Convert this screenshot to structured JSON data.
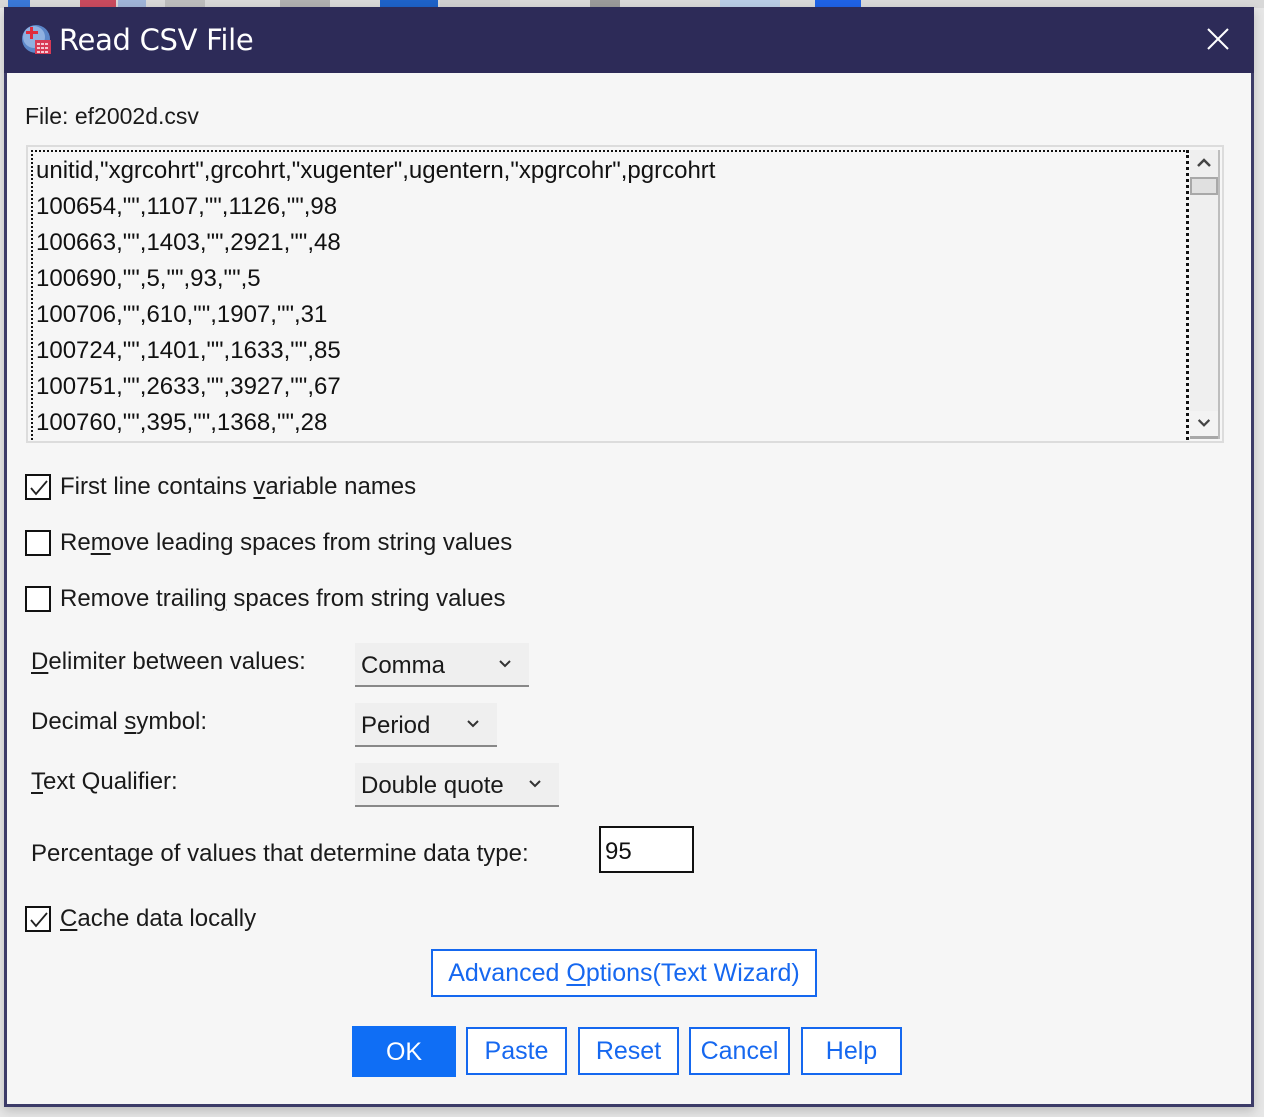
{
  "window": {
    "title": "Read CSV File",
    "close_icon": "close-icon",
    "app_icon": "spss-data-icon"
  },
  "file": {
    "label": "File: ef2002d.csv"
  },
  "preview": {
    "lines": [
      "unitid,\"xgrcohrt\",grcohrt,\"xugenter\",ugentern,\"xpgrcohr\",pgrcohrt",
      "100654,\"\",1107,\"\",1126,\"\",98",
      "100663,\"\",1403,\"\",2921,\"\",48",
      "100690,\"\",5,\"\",93,\"\",5",
      "100706,\"\",610,\"\",1907,\"\",31",
      "100724,\"\",1401,\"\",1633,\"\",85",
      "100751,\"\",2633,\"\",3927,\"\",67",
      "100760,\"\",395,\"\",1368,\"\",28"
    ],
    "scroll_up_icon": "chevron-up-icon",
    "scroll_down_icon": "chevron-down-icon"
  },
  "options": {
    "first_line": {
      "pre": "First line contains ",
      "u": "v",
      "post": "ariable names",
      "checked": true
    },
    "leading": {
      "pre": "Re",
      "u": "m",
      "post": "ove leading spaces from string values",
      "checked": false
    },
    "trailing": {
      "pre": "Remove trailin",
      "u": "g",
      "post": " spaces from string values",
      "checked": false
    },
    "cache": {
      "pre": "",
      "u": "C",
      "post": "ache data locally",
      "checked": true
    }
  },
  "fields": {
    "delimiter": {
      "label_u": "D",
      "label_rest": "elimiter between values:",
      "value": "Comma"
    },
    "decimal": {
      "label_pre": "Decimal ",
      "label_u": "s",
      "label_rest": "ymbol:",
      "value": "Period"
    },
    "qualifier": {
      "label_u": "T",
      "label_rest": "ext Qualifier:",
      "value": "Double quote"
    },
    "percentage": {
      "label": "Percentage of values that determine data type:",
      "value": "95"
    }
  },
  "buttons": {
    "advanced": {
      "pre": "Advanced ",
      "u": "O",
      "post": "ptions(Text Wizard)"
    },
    "ok": "OK",
    "paste": "Paste",
    "reset": "Reset",
    "cancel": "Cancel",
    "help": "Help"
  },
  "colors": {
    "titlebar": "#2d2b58",
    "accent": "#0f6ef5",
    "background": "#f6f6f6"
  }
}
